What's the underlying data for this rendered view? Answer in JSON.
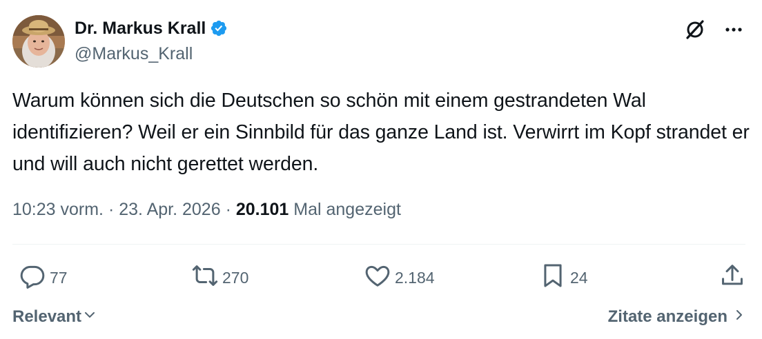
{
  "author": {
    "display_name": "Dr. Markus Krall",
    "handle": "@Markus_Krall",
    "verified": true
  },
  "tweet": {
    "text": "Warum können sich die Deutschen so schön mit einem gestrandeten Wal identifizieren? Weil er ein Sinnbild für das ganze Land ist. Verwirrt im Kopf strandet er und will auch nicht gerettet werden.",
    "time": "10:23 vorm.",
    "date": "23. Apr. 2026",
    "views_count": "20.101",
    "views_label": "Mal angezeigt"
  },
  "actions": {
    "replies": "77",
    "reposts": "270",
    "likes": "2.184",
    "bookmarks": "24"
  },
  "footer": {
    "sort_label": "Relevant",
    "quotes_label": "Zitate anzeigen"
  },
  "icons": {
    "verified": "verified-badge-icon",
    "grok": "grok-icon",
    "more": "more-icon",
    "reply": "reply-icon",
    "repost": "repost-icon",
    "like": "heart-icon",
    "bookmark": "bookmark-icon",
    "share": "share-icon"
  },
  "colors": {
    "verified_blue": "#1d9bf0",
    "text_primary": "#0f1419",
    "text_secondary": "#536471",
    "divider": "#eff3f4"
  }
}
